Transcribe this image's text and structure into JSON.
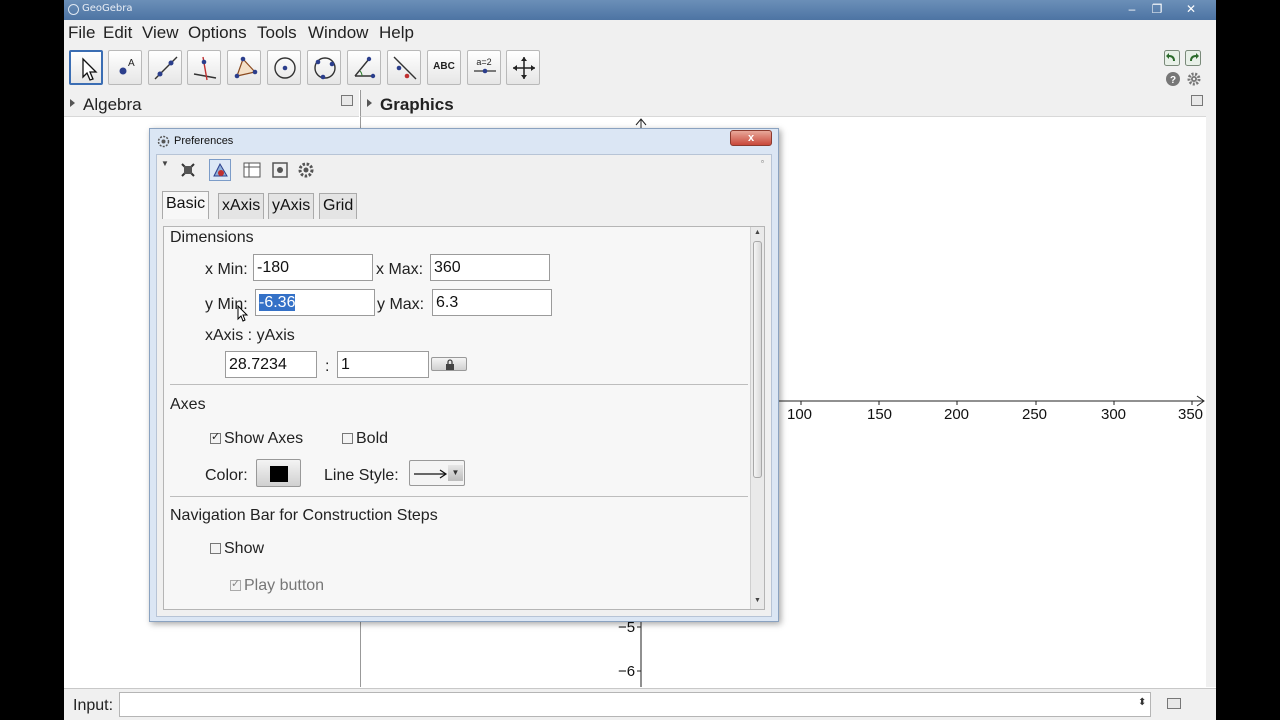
{
  "window": {
    "title": "GeoGebra",
    "controls": [
      "–",
      "❐",
      "✕"
    ]
  },
  "menu": [
    "File",
    "Edit",
    "View",
    "Options",
    "Tools",
    "Window",
    "Help"
  ],
  "toolbar": {
    "tools": [
      "move-tool",
      "point-tool",
      "line-tool",
      "perpendicular-tool",
      "polygon-tool",
      "circle-tool",
      "conic-tool",
      "angle-tool",
      "reflect-tool",
      "text-tool",
      "slider-tool",
      "move-graphics-tool"
    ],
    "text_tool_label": "ABC",
    "slider_tool_label": "a=2"
  },
  "panels": {
    "algebra": "Algebra",
    "graphics": "Graphics"
  },
  "graphics": {
    "x_ticks": [
      "100",
      "150",
      "200",
      "250",
      "300",
      "350"
    ],
    "y_ticks": [
      "−5",
      "−6"
    ]
  },
  "input_bar": {
    "label": "Input:",
    "value": ""
  },
  "preferences": {
    "title": "Preferences",
    "tabs": [
      "Basic",
      "xAxis",
      "yAxis",
      "Grid"
    ],
    "active_tab": "Basic",
    "dimensions": {
      "heading": "Dimensions",
      "x_min_label": "x Min:",
      "x_min": "-180",
      "x_max_label": "x Max:",
      "x_max": "360",
      "y_min_label": "y Min:",
      "y_min": "-6.36",
      "y_max_label": "y Max:",
      "y_max": "6.3",
      "ratio_label": "xAxis : yAxis",
      "ratio_x": "28.7234",
      "ratio_sep": ":",
      "ratio_y": "1"
    },
    "axes": {
      "heading": "Axes",
      "show_axes_label": "Show Axes",
      "show_axes": true,
      "bold_label": "Bold",
      "bold": false,
      "color_label": "Color:",
      "color": "#000000",
      "line_style_label": "Line Style:"
    },
    "navigation": {
      "heading": "Navigation Bar for Construction Steps",
      "show_label": "Show",
      "show": false,
      "play_label": "Play button",
      "play": true
    }
  }
}
